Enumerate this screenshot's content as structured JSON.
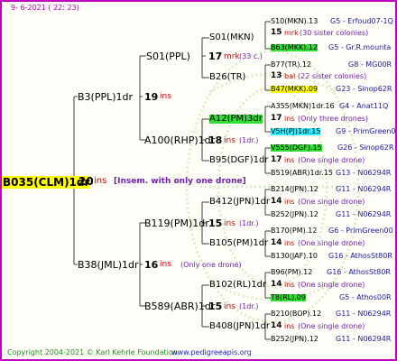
{
  "header": {
    "date": "9-  6-2021 ( 22: 23)"
  },
  "footer": {
    "copyright": "Copyright 2004-2021 © Karl Kehrle Foundation",
    "url": "www.pedigreeapis.org"
  },
  "root": {
    "name": "B035(CLM)1dr",
    "num": "20",
    "ins": "ins",
    "note": "[Insem. with only one drone]"
  },
  "gen1": [
    {
      "name": "B3(PPL)1dr",
      "num": "19",
      "ins": "ins"
    },
    {
      "name": "B38(JML)1dr",
      "num": "16",
      "ins": "ins",
      "note": "(Only one drone)"
    }
  ],
  "gen2": [
    {
      "name": "S01(PPL)",
      "num": "17",
      "ins": "mrk",
      "note": "(33 c.)"
    },
    {
      "name": "A100(RHP)1dr",
      "num": "18",
      "ins": "ins",
      "note": "(1dr.)"
    },
    {
      "name": "B119(PM)1dr",
      "num": "15",
      "ins": "ins",
      "note": "(1dr.)"
    },
    {
      "name": "B589(ABR)1dr",
      "num": "15",
      "ins": "ins",
      "note": "(1dr.)"
    }
  ],
  "gen3": [
    {
      "name": "S01(MKN)"
    },
    {
      "name": "B26(TR)"
    },
    {
      "name": "A12(PM)3dr"
    },
    {
      "name": "B95(DGF)1dr"
    },
    {
      "name": "B412(JPN)1dr"
    },
    {
      "name": "B105(PM)1dr"
    },
    {
      "name": "B102(RL)1dr"
    },
    {
      "name": "B408(JPN)1dr"
    }
  ],
  "gen4": [
    {
      "line1": "S10(MKN).13",
      "code1": "G5 - Erfoud07-1Q",
      "num": "15",
      "ins": "mrk",
      "note": "(30 sister colonies)",
      "line2": "B63(MKK).12",
      "code2": "G5 - Gr.R.mounta"
    },
    {
      "line1": "B77(TR).12",
      "code1": "G8 - MG00R",
      "num": "13",
      "ins": "bal",
      "note": "(22 sister colonies)",
      "line2": "B47(MKK).09",
      "code2": "G23 - Sinop62R"
    },
    {
      "line1": "A355(MKN)1dr.16",
      "code1": "G4 - Anat11Q",
      "num": "17",
      "ins": "ins",
      "note": "(Only three drones)",
      "line2": "V5H(PJ)1dr.15",
      "code2": "G9 - PrimGreen00"
    },
    {
      "line1": "V555(DGF).15",
      "code1": "G26 - Sinop62R",
      "num": "17",
      "ins": "ins",
      "note": "(One single drone)",
      "line2": "B519(ABR)1dr.15",
      "code2": "G13 - N06294R"
    },
    {
      "line1": "B214(JPN).12",
      "code1": "G11 - N06294R",
      "num": "14",
      "ins": "ins",
      "note": "(One single drone)",
      "line2": "B252(JPN).12",
      "code2": "G11 - N06294R"
    },
    {
      "line1": "B170(PM).12",
      "code1": "G6 - PrimGreen00",
      "num": "14",
      "ins": "ins",
      "note": "(One single drone)",
      "line2": "B130(JAF).10",
      "code2": "G16 - AthosSt80R"
    },
    {
      "line1": "B96(PM).12",
      "code1": "G16 - AthosSt80R",
      "num": "14",
      "ins": "ins",
      "note": "(One single drone)",
      "line2": "T8(RL).09",
      "code2": "G5 - Athos00R"
    },
    {
      "line1": "B210(BOP).12",
      "code1": "G11 - N06294R",
      "num": "14",
      "ins": "ins",
      "note": "(One single drone)",
      "line2": "B252(JPN).12",
      "code2": "G11 - N06294R"
    }
  ],
  "colors": {
    "frame": "#c000c0",
    "ins": "#d00000",
    "note": "#7020b0",
    "code": "#1a1aa0",
    "highlight_yellow": "#ffff00",
    "highlight_green": "#33dd33",
    "highlight_cyan": "#33eeff"
  }
}
